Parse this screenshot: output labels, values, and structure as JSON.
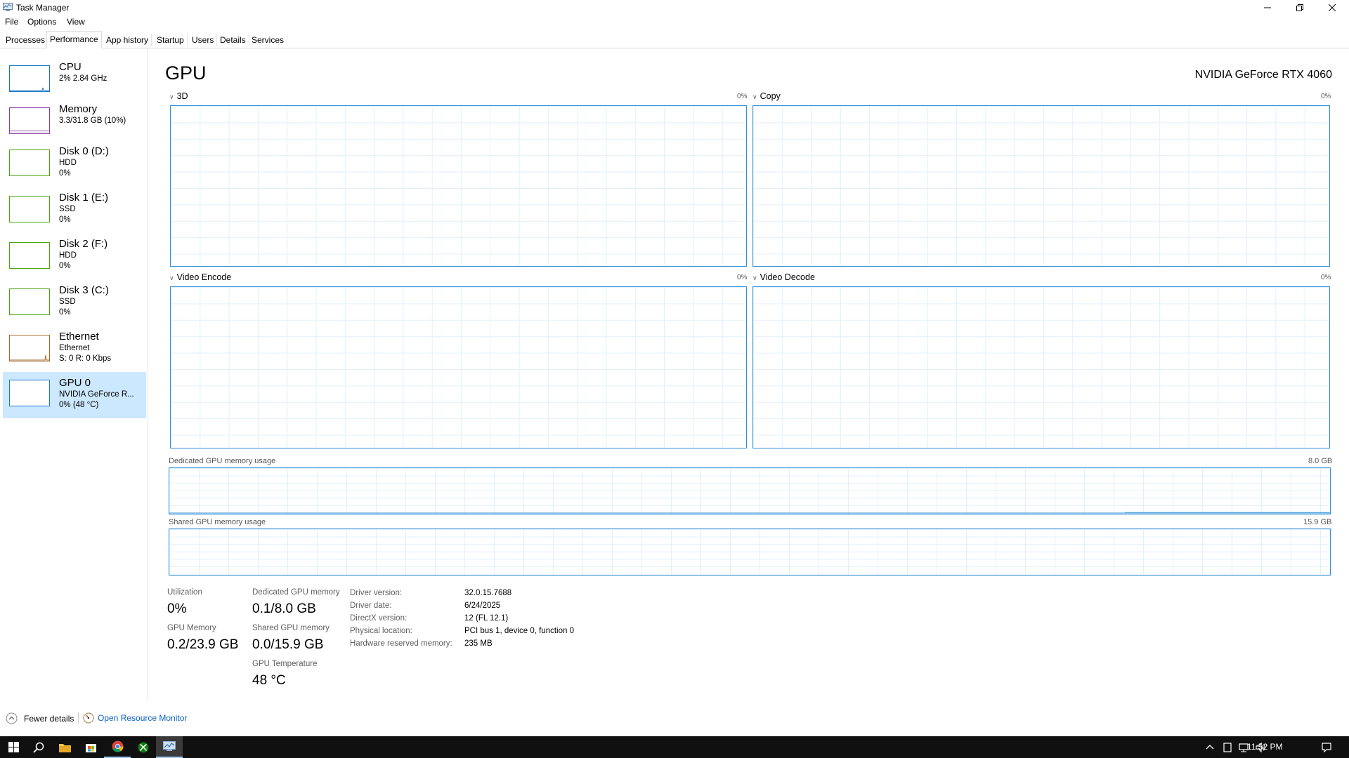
{
  "window": {
    "title": "Task Manager",
    "icons": {
      "app": "task-manager-icon",
      "minimize": "minimize-icon",
      "maximize": "restore-icon",
      "close": "close-icon"
    }
  },
  "menu": [
    "File",
    "Options",
    "View"
  ],
  "tabs": [
    {
      "label": "Processes",
      "active": false
    },
    {
      "label": "Performance",
      "active": true
    },
    {
      "label": "App history",
      "active": false
    },
    {
      "label": "Startup",
      "active": false
    },
    {
      "label": "Users",
      "active": false
    },
    {
      "label": "Details",
      "active": false
    },
    {
      "label": "Services",
      "active": false
    }
  ],
  "sidebar": [
    {
      "name": "CPU",
      "lines": [
        "2% 2.84 GHz"
      ],
      "color": "#1a78c8",
      "selected": false
    },
    {
      "name": "Memory",
      "lines": [
        "3.3/31.8 GB (10%)"
      ],
      "color": "#8b3fa6",
      "selected": false
    },
    {
      "name": "Disk 0 (D:)",
      "lines": [
        "HDD",
        "0%"
      ],
      "color": "#4da60c",
      "selected": false
    },
    {
      "name": "Disk 1 (E:)",
      "lines": [
        "SSD",
        "0%"
      ],
      "color": "#4da60c",
      "selected": false
    },
    {
      "name": "Disk 2 (F:)",
      "lines": [
        "HDD",
        "0%"
      ],
      "color": "#4da60c",
      "selected": false
    },
    {
      "name": "Disk 3 (C:)",
      "lines": [
        "SSD",
        "0%"
      ],
      "color": "#4da60c",
      "selected": false
    },
    {
      "name": "Ethernet",
      "lines": [
        "Ethernet",
        "S: 0 R: 0 Kbps"
      ],
      "color": "#a7692a",
      "selected": false
    },
    {
      "name": "GPU 0",
      "lines": [
        "NVIDIA GeForce R...",
        "0% (48 °C)"
      ],
      "color": "#1a78c8",
      "selected": true
    }
  ],
  "main": {
    "title": "GPU",
    "model": "NVIDIA GeForce RTX 4060",
    "engines": [
      {
        "label": "3D",
        "pct": "0%"
      },
      {
        "label": "Copy",
        "pct": "0%"
      },
      {
        "label": "Video Encode",
        "pct": "0%"
      },
      {
        "label": "Video Decode",
        "pct": "0%"
      }
    ],
    "dedicated_mem": {
      "label": "Dedicated GPU memory usage",
      "max": "8.0 GB"
    },
    "shared_mem": {
      "label": "Shared GPU memory usage",
      "max": "15.9 GB"
    }
  },
  "stats": {
    "utilization": {
      "label": "Utilization",
      "value": "0%"
    },
    "dedicated": {
      "label": "Dedicated GPU memory",
      "value": "0.1/8.0 GB"
    },
    "gpu_memory": {
      "label": "GPU Memory",
      "value": "0.2/23.9 GB"
    },
    "shared": {
      "label": "Shared GPU memory",
      "value": "0.0/15.9 GB"
    },
    "temperature": {
      "label": "GPU Temperature",
      "value": "48 °C"
    }
  },
  "info": [
    {
      "key": "Driver version:",
      "value": "32.0.15.7688"
    },
    {
      "key": "Driver date:",
      "value": "6/24/2025"
    },
    {
      "key": "DirectX version:",
      "value": "12 (FL 12.1)"
    },
    {
      "key": "Physical location:",
      "value": "PCI bus 1, device 0, function 0"
    },
    {
      "key": "Hardware reserved memory:",
      "value": "235 MB"
    }
  ],
  "footer": {
    "fewer_details": "Fewer details",
    "open_resource_monitor": "Open Resource Monitor"
  },
  "taskbar": {
    "apps": [
      "start-icon",
      "search-icon",
      "file-explorer-icon",
      "store-icon",
      "chrome-icon",
      "xbox-icon",
      "task-manager-icon"
    ],
    "tray": [
      "chevron-up-icon",
      "tablet-icon",
      "network-icon",
      "volume-icon"
    ],
    "clock": "11:52 PM",
    "notification": "notification-icon"
  }
}
